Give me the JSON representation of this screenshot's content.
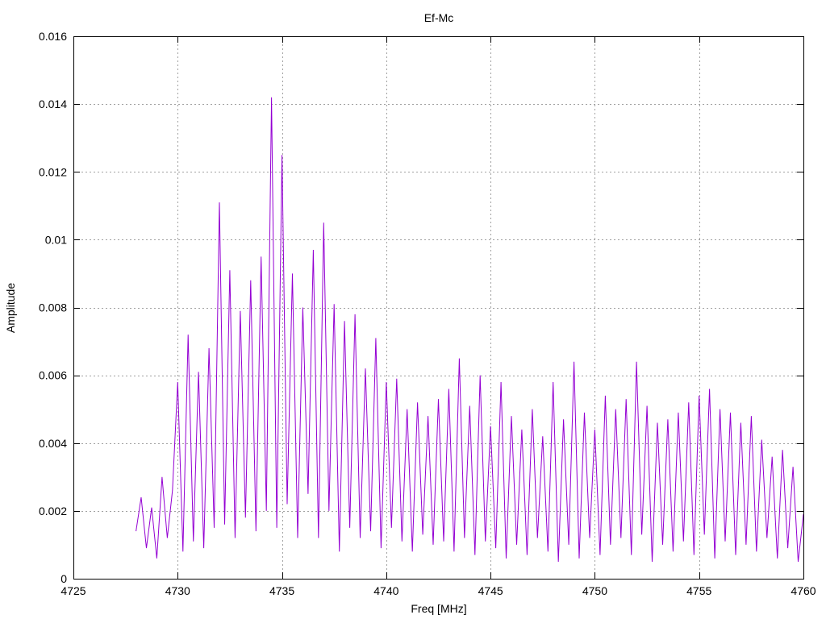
{
  "chart_data": {
    "type": "line",
    "title": "Ef-Mc",
    "xlabel": "Freq [MHz]",
    "ylabel": "Amplitude",
    "xlim": [
      4725,
      4760
    ],
    "ylim": [
      0,
      0.016
    ],
    "x_ticks": [
      4725,
      4730,
      4735,
      4740,
      4745,
      4750,
      4755,
      4760
    ],
    "x_tick_labels": [
      "4725",
      "4730",
      "4735",
      "4740",
      "4745",
      "4750",
      "4755",
      "4760"
    ],
    "y_ticks": [
      0,
      0.002,
      0.004,
      0.006,
      0.008,
      0.01,
      0.012,
      0.014,
      0.016
    ],
    "y_tick_labels": [
      "0",
      "0.002",
      "0.004",
      "0.006",
      "0.008",
      "0.01",
      "0.012",
      "0.014",
      "0.016"
    ],
    "grid": true,
    "line_color": "#9400d3",
    "series": [
      {
        "x": [
          4728,
          4728.25,
          4728.5,
          4728.75,
          4729,
          4729.25,
          4729.5,
          4729.75,
          4730,
          4730.25,
          4730.5,
          4730.75,
          4731,
          4731.25,
          4731.5,
          4731.75,
          4732,
          4732.25,
          4732.5,
          4732.75,
          4733,
          4733.25,
          4733.5,
          4733.75,
          4734,
          4734.25,
          4734.5,
          4734.75,
          4735,
          4735.25,
          4735.5,
          4735.75,
          4736,
          4736.25,
          4736.5,
          4736.75,
          4737,
          4737.25,
          4737.5,
          4737.75,
          4738,
          4738.25,
          4738.5,
          4738.75,
          4739,
          4739.25,
          4739.5,
          4739.75,
          4740,
          4740.25,
          4740.5,
          4740.75,
          4741,
          4741.25,
          4741.5,
          4741.75,
          4742,
          4742.25,
          4742.5,
          4742.75,
          4743,
          4743.25,
          4743.5,
          4743.75,
          4744,
          4744.25,
          4744.5,
          4744.75,
          4745,
          4745.25,
          4745.5,
          4745.75,
          4746,
          4746.25,
          4746.5,
          4746.75,
          4747,
          4747.25,
          4747.5,
          4747.75,
          4748,
          4748.25,
          4748.5,
          4748.75,
          4749,
          4749.25,
          4749.5,
          4749.75,
          4750,
          4750.25,
          4750.5,
          4750.75,
          4751,
          4751.25,
          4751.5,
          4751.75,
          4752,
          4752.25,
          4752.5,
          4752.75,
          4753,
          4753.25,
          4753.5,
          4753.75,
          4754,
          4754.25,
          4754.5,
          4754.75,
          4755,
          4755.25,
          4755.5,
          4755.75,
          4756,
          4756.25,
          4756.5,
          4756.75,
          4757,
          4757.25,
          4757.5,
          4757.75,
          4758,
          4758.25,
          4758.5,
          4758.75,
          4759,
          4759.25,
          4759.5,
          4759.75,
          4760
        ],
        "y": [
          0.0014,
          0.0024,
          0.0009,
          0.0021,
          0.0006,
          0.003,
          0.0012,
          0.0026,
          0.0058,
          0.0008,
          0.0072,
          0.0011,
          0.0061,
          0.0009,
          0.0068,
          0.0015,
          0.0111,
          0.0016,
          0.0091,
          0.0012,
          0.0079,
          0.0018,
          0.0088,
          0.0014,
          0.0095,
          0.002,
          0.0142,
          0.0015,
          0.0125,
          0.0022,
          0.009,
          0.0012,
          0.008,
          0.0025,
          0.0097,
          0.0012,
          0.0105,
          0.002,
          0.0081,
          0.0008,
          0.0076,
          0.0015,
          0.0078,
          0.0012,
          0.0062,
          0.0014,
          0.0071,
          0.0009,
          0.0058,
          0.0015,
          0.0059,
          0.0011,
          0.005,
          0.0008,
          0.0052,
          0.0013,
          0.0048,
          0.001,
          0.0053,
          0.0011,
          0.0056,
          0.0008,
          0.0065,
          0.0012,
          0.0051,
          0.0007,
          0.006,
          0.0011,
          0.0045,
          0.0009,
          0.0058,
          0.0006,
          0.0048,
          0.001,
          0.0044,
          0.0007,
          0.005,
          0.0012,
          0.0042,
          0.0008,
          0.0058,
          0.0005,
          0.0047,
          0.001,
          0.0064,
          0.0006,
          0.0049,
          0.0012,
          0.0044,
          0.0007,
          0.0054,
          0.001,
          0.005,
          0.0012,
          0.0053,
          0.0007,
          0.0064,
          0.0013,
          0.0051,
          0.0005,
          0.0046,
          0.001,
          0.0047,
          0.0008,
          0.0049,
          0.0011,
          0.0052,
          0.0007,
          0.0054,
          0.0013,
          0.0056,
          0.0006,
          0.005,
          0.0011,
          0.0049,
          0.0007,
          0.0046,
          0.001,
          0.0048,
          0.0008,
          0.0041,
          0.0012,
          0.0036,
          0.0006,
          0.0038,
          0.0009,
          0.0033,
          0.0005,
          0.0019
        ]
      }
    ]
  }
}
